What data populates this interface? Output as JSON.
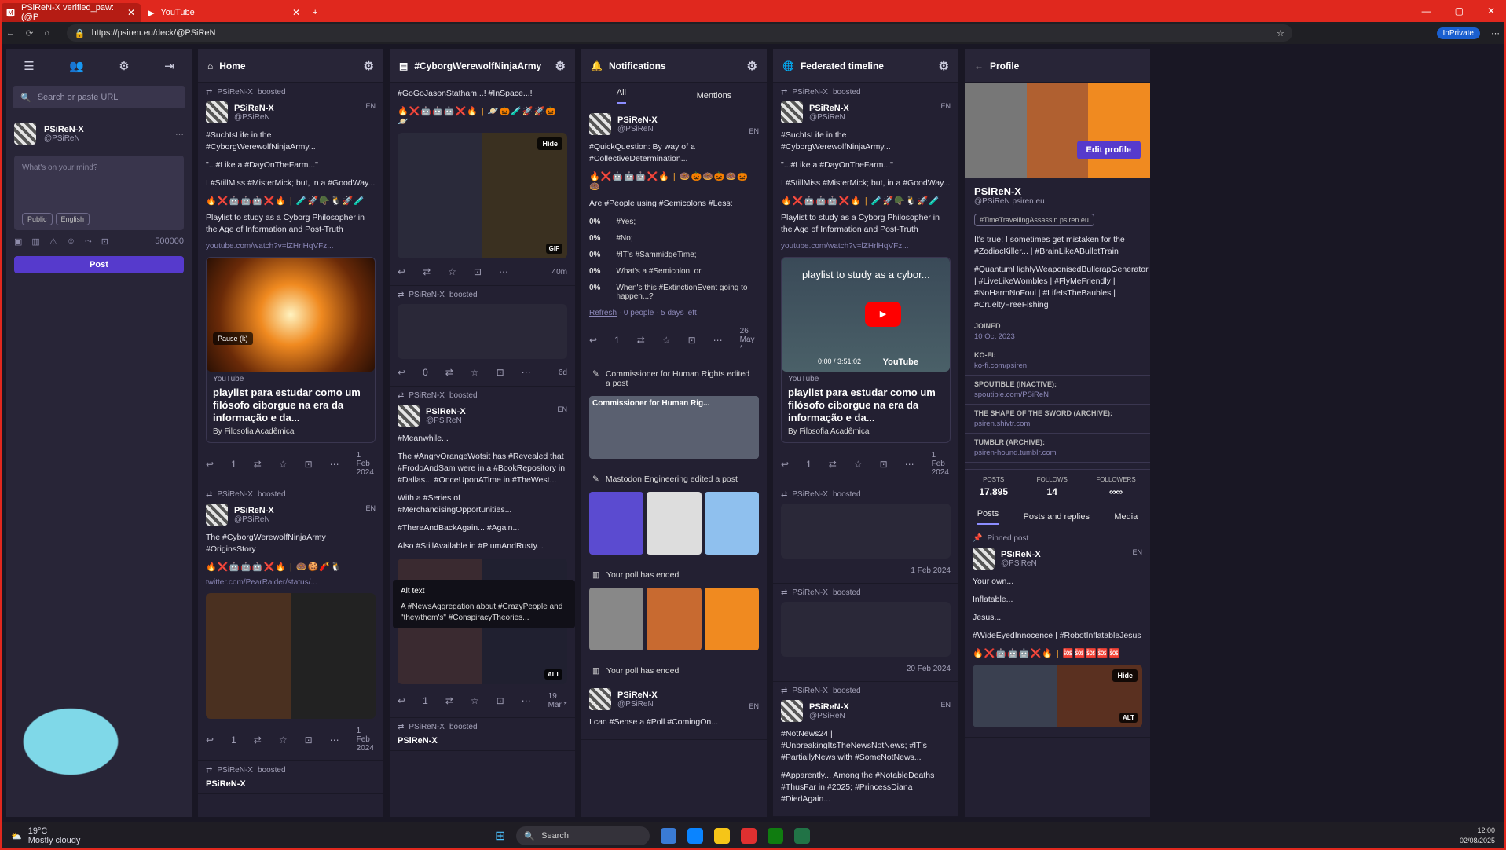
{
  "browser": {
    "tab1": "PSiReN-X verified_paw: (@P",
    "tab2": "YouTube",
    "url": "https://psiren.eu/deck/@PSiReN",
    "inprivate": "InPrivate"
  },
  "left": {
    "search_placeholder": "Search or paste URL",
    "name": "PSiReN-X",
    "handle": "@PSiReN",
    "compose_placeholder": "What's on your mind?",
    "visibility": "Public",
    "language": "English",
    "counter": "500000",
    "post": "Post"
  },
  "home": {
    "title": "Home",
    "p1": {
      "boost": "PSiReN-X",
      "boosted": "boosted",
      "name": "PSiReN-X",
      "handle": "@PSiReN",
      "lang": "EN",
      "t1": "#SuchIsLife in the #CyborgWerewolfNinjaArmy...",
      "t2": "\"...#Like a #DayOnTheFarm...\"",
      "t3": "I #StillMiss #MisterMick; but, in a #GoodWay...",
      "emoji": "🔥❌🤖🤖🤖❌🔥 | 🧪🚀🪖🐧🚀🧪",
      "t4": "Playlist to study as a Cyborg Philosopher in the Age of Information and Post-Truth",
      "link": "youtube.com/watch?v=lZHrlHqVFz...",
      "pause": "Pause (k)",
      "src": "YouTube",
      "title": "playlist para estudar como um filósofo ciborgue na era da informação e da...",
      "by": "By Filosofia Acadêmica",
      "reblogs": "1",
      "date": "1 Feb 2024"
    },
    "p2": {
      "boost": "PSiReN-X",
      "boosted": "boosted",
      "name": "PSiReN-X",
      "handle": "@PSiReN",
      "lang": "EN",
      "t1": "The #CyborgWerewolfNinjaArmy #OriginsStory",
      "emoji": "🔥❌🤖🤖🤖❌🔥 | 🍩🍪🧨🐧",
      "link": "twitter.com/PearRaider/status/...",
      "reblogs": "1",
      "date": "1 Feb 2024"
    },
    "p3": {
      "boost": "PSiReN-X",
      "boosted": "boosted",
      "name": "PSiReN-X"
    }
  },
  "army": {
    "title": "#CyborgWerewolfNinjaArmy",
    "top": "#GoGoJasonStatham...! #InSpace...!",
    "emoji": "🔥❌🤖🤖🤖❌🔥 | 🪐🎃🧪🚀🚀🎃🪐",
    "hide": "Hide",
    "alt": "ALT",
    "gif": "GIF",
    "reblogs": "",
    "date1": "40m",
    "p2": {
      "boost": "PSiReN-X",
      "boosted": "boosted",
      "name": "PSiReN-X",
      "handle": "@PSiReN",
      "reblogs": "0",
      "date": "6d"
    },
    "p3": {
      "boost": "PSiReN-X",
      "boosted": "boosted",
      "name": "PSiReN-X",
      "handle": "@PSiReN",
      "lang": "EN",
      "t1": "#Meanwhile...",
      "t2": "The #AngryOrangeWotsit has #Revealed that #FrodoAndSam were in a #BookRepository in #Dallas... #OnceUponATime in #TheWest...",
      "t3": "With a #Series of #MerchandisingOpportunities...",
      "t4": "#ThereAndBackAgain... #Again...",
      "t5": "Also #StillAvailable in #PlumAndRusty...",
      "reblogs": "1",
      "date": "19 Mar *"
    },
    "p4": {
      "boost": "PSiReN-X",
      "boosted": "boosted",
      "name": "PSiReN-X"
    },
    "tooltip_title": "Alt text",
    "tooltip_text": "A #NewsAggregation about #CrazyPeople and \"they/them's\" #ConspiracyTheories..."
  },
  "notif": {
    "title": "Notifications",
    "tab_all": "All",
    "tab_mentions": "Mentions",
    "p1": {
      "name": "PSiReN-X",
      "handle": "@PSiReN",
      "lang": "EN",
      "t1": "#QuickQuestion: By way of a #CollectiveDetermination...",
      "emoji": "🔥❌🤖🤖🤖❌🔥 | 🍩🎃🍩🎃🍩🎃🍩",
      "t2": "Are #People using #Semicolons #Less:",
      "polls": [
        {
          "pct": "0%",
          "label": "#Yes;"
        },
        {
          "pct": "0%",
          "label": "#No;"
        },
        {
          "pct": "0%",
          "label": "#IT's #SammidgeTime;"
        },
        {
          "pct": "0%",
          "label": "What's a #Semicolon; or,"
        },
        {
          "pct": "0%",
          "label": "When's this #ExtinctionEvent going to happen...?"
        }
      ],
      "refresh": "Refresh",
      "pollmeta": " · 0 people · 5 days left",
      "reblogs": "1",
      "date": "26 May *"
    },
    "n2": "Commissioner for Human Rights edited a post",
    "n2card": "Commissioner for Human Rig...",
    "n3": "Mastodon Engineering edited a post",
    "n4": "Your poll has ended",
    "n5": "Your poll has ended",
    "p5": {
      "name": "PSiReN-X",
      "handle": "@PSiReN",
      "lang": "EN",
      "t1": "I can #Sense a #Poll #ComingOn..."
    }
  },
  "fed": {
    "title": "Federated timeline",
    "p1": {
      "boost": "PSiReN-X",
      "boosted": "boosted",
      "name": "PSiReN-X",
      "handle": "@PSiReN",
      "lang": "EN",
      "t1": "#SuchIsLife in the #CyborgWerewolfNinjaArmy...",
      "t2": "\"...#Like a #DayOnTheFarm...\"",
      "t3": "I #StillMiss #MisterMick; but, in a #GoodWay...",
      "emoji": "🔥❌🤖🤖🤖❌🔥 | 🧪🚀🪖🐧🚀🧪",
      "t4": "Playlist to study as a Cyborg Philosopher in the Age of Information and Post-Truth",
      "link": "youtube.com/watch?v=lZHrlHqVFz...",
      "yt": "playlist to study as a cybor...",
      "time": "0:00 / 3:51:02",
      "ytlogo": "YouTube",
      "src": "YouTube",
      "title": "playlist para estudar como um filósofo ciborgue na era da informação e da...",
      "by": "By Filosofia Acadêmica",
      "reblogs": "1",
      "date": "1 Feb 2024"
    },
    "p2": {
      "boost": "PSiReN-X",
      "boosted": "boosted",
      "date": "1 Feb 2024"
    },
    "p3": {
      "boost": "PSiReN-X",
      "boosted": "boosted",
      "date": "20 Feb 2024"
    },
    "p4": {
      "boost": "PSiReN-X",
      "boosted": "boosted",
      "name": "PSiReN-X",
      "handle": "@PSiReN",
      "lang": "EN",
      "t1": "#NotNews24 | #UnbreakingItsTheNewsNotNews; #IT's #PartiallyNews with #SomeNotNews...",
      "t2": "#Apparently... Among the #NotableDeaths #ThusFar in #2025; #PrincessDiana #DiedAgain..."
    }
  },
  "profile": {
    "title": "Profile",
    "edit": "Edit profile",
    "name": "PSiReN-X",
    "handle": "@PSiReN",
    "domain": "psiren.eu",
    "tag": "#TimeTravellingAssassin",
    "tagdomain": "psiren.eu",
    "bio1": "It's true; I sometimes get mistaken for the #ZodiacKiller... | #BrainLikeABulletTrain",
    "bio2": "#QuantumHighlyWeaponisedBullcrapGenerator | #LiveLikeWombles | #FlyMeFriendly | #NoHarmNoFoul | #LifeIsTheBaubles | #CrueltyFreeFishing",
    "fields": [
      {
        "k": "JOINED",
        "v": "10 Oct 2023"
      },
      {
        "k": "KO-FI:",
        "v": "ko-fi.com/psiren"
      },
      {
        "k": "SPOUTIBLE (INACTIVE):",
        "v": "spoutible.com/PSiReN"
      },
      {
        "k": "THE SHAPE OF THE SWORD (ARCHIVE):",
        "v": "psiren.shivtr.com"
      },
      {
        "k": "TUMBLR (ARCHIVE):",
        "v": "psiren-hound.tumblr.com"
      }
    ],
    "posts_k": "POSTS",
    "posts_v": "17,895",
    "follows_k": "FOLLOWS",
    "follows_v": "14",
    "followers_k": "FOLLOWERS",
    "followers_v": "∞∞",
    "tab_posts": "Posts",
    "tab_replies": "Posts and replies",
    "tab_media": "Media",
    "pinned": "Pinned post",
    "pname": "PSiReN-X",
    "phandle": "@PSiReN",
    "lang": "EN",
    "l1": "Your own...",
    "l2": "Inflatable...",
    "l3": "Jesus...",
    "l4": "#WideEyedInnocence | #RobotInflatableJesus",
    "emoji": "🔥❌🤖🤖🤖❌🔥 | 🆘🆘🆘🆘🆘",
    "hide": "Hide",
    "alt": "ALT"
  },
  "taskbar": {
    "temp": "19°C",
    "weather": "Mostly cloudy",
    "search": "Search",
    "time": "12:00",
    "date": "02/08/2025"
  }
}
